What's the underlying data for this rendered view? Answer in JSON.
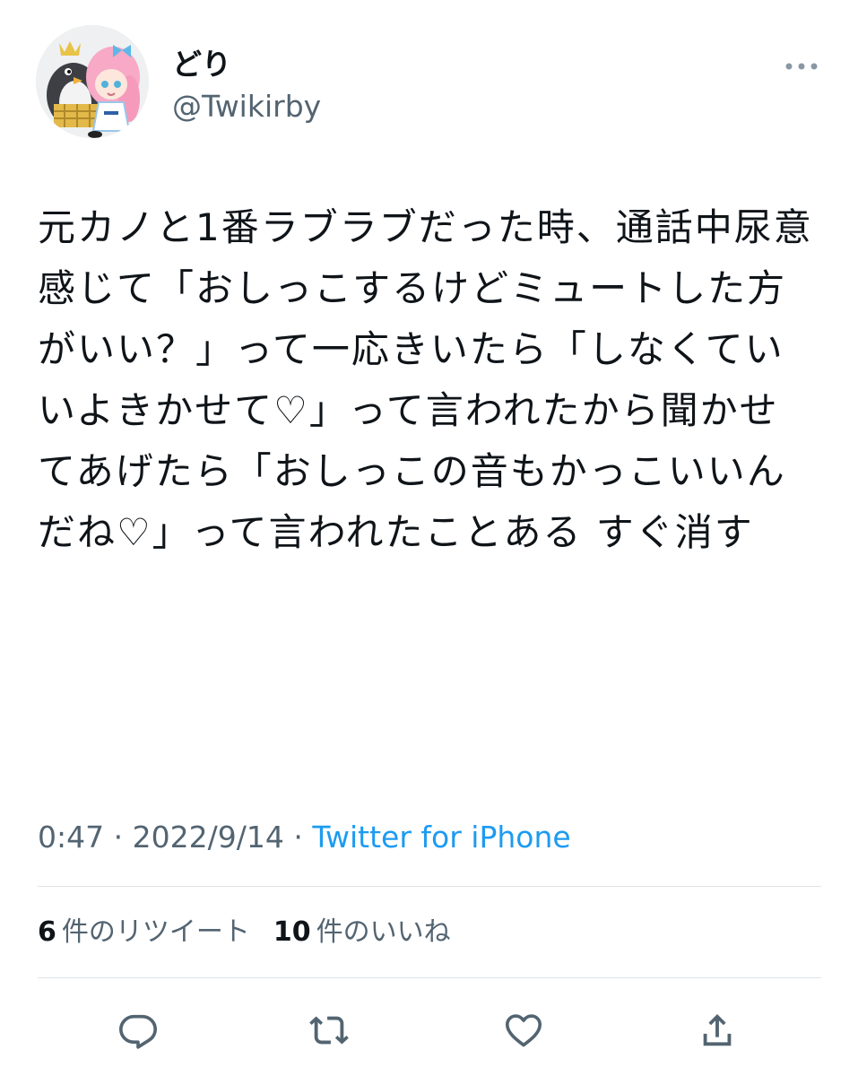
{
  "user": {
    "display_name": "どり",
    "handle": "@Twikirby"
  },
  "tweet": {
    "text": "元カノと1番ラブラブだった時、通話中尿意感じて「おしっこするけどミュートした方がいい？」って一応きいたら「しなくていいよきかせて♡」って言われたから聞かせてあげたら「おしっこの音もかっこいいんだね♡」って言われたことある すぐ消す",
    "time": "0:47",
    "separator": "·",
    "date": "2022/9/14",
    "source": "Twitter for iPhone"
  },
  "stats": {
    "retweets_count": "6",
    "retweets_label": "件のリツイート",
    "likes_count": "10",
    "likes_label": "件のいいね"
  },
  "icons": {
    "more": "more-dots-icon",
    "reply": "reply-bubble-icon",
    "retweet": "retweet-icon",
    "like": "heart-icon",
    "share": "share-upload-icon"
  },
  "colors": {
    "text": "#0f1419",
    "secondary": "#536471",
    "link": "#1d9bf0",
    "divider": "#dfe3e6",
    "icon": "#536471"
  }
}
